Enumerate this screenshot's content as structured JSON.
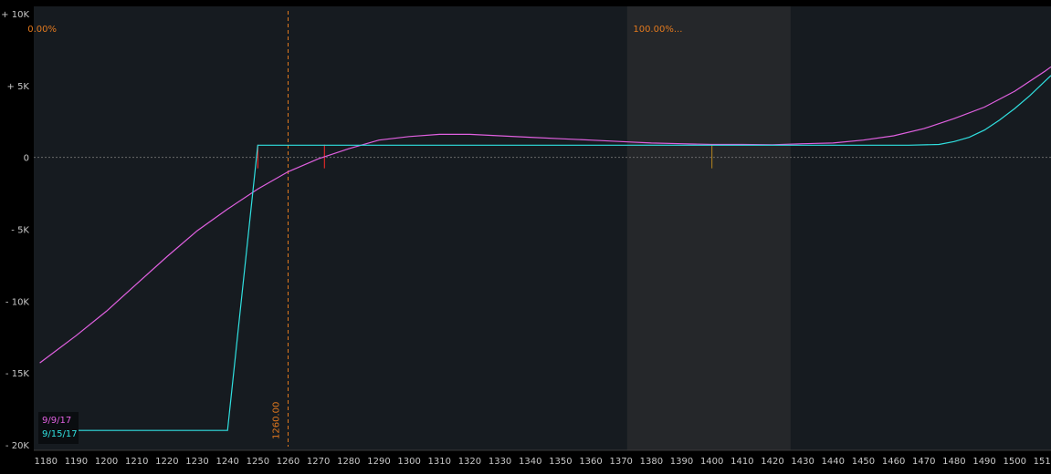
{
  "chart_data": {
    "type": "line",
    "xlim": [
      1176,
      1512
    ],
    "ylim": [
      -20000,
      10000
    ],
    "x_ticks": [
      1180,
      1190,
      1200,
      1210,
      1220,
      1230,
      1240,
      1250,
      1260,
      1270,
      1280,
      1290,
      1300,
      1310,
      1320,
      1330,
      1340,
      1350,
      1360,
      1370,
      1380,
      1390,
      1400,
      1410,
      1420,
      1430,
      1440,
      1450,
      1460,
      1470,
      1480,
      1490,
      1500,
      1510
    ],
    "y_ticks": [
      {
        "value": 10000,
        "label": "+ 10K"
      },
      {
        "value": 5000,
        "label": "+ 5K"
      },
      {
        "value": 0,
        "label": "0"
      },
      {
        "value": -5000,
        "label": "- 5K"
      },
      {
        "value": -10000,
        "label": "- 10K"
      },
      {
        "value": -15000,
        "label": "- 15K"
      },
      {
        "value": -20000,
        "label": "- 20K"
      }
    ],
    "shaded_range": [
      1372,
      1426
    ],
    "price_marker": {
      "x": 1260,
      "label": "1260.00"
    },
    "probability_labels": [
      {
        "x": 1180,
        "text": "0.00%"
      },
      {
        "x": 1380,
        "text": "100.00%..."
      }
    ],
    "zero_line": true,
    "markers": [
      {
        "x": 1250,
        "color": "#ff2a2a"
      },
      {
        "x": 1272,
        "color": "#ff2a2a"
      },
      {
        "x": 1400,
        "color": "#b8861e"
      }
    ],
    "series": [
      {
        "name": "9/9/17",
        "color": "#e060e0",
        "x": [
          1178,
          1190,
          1200,
          1210,
          1220,
          1230,
          1240,
          1250,
          1260,
          1270,
          1280,
          1290,
          1300,
          1310,
          1320,
          1330,
          1340,
          1350,
          1360,
          1370,
          1380,
          1390,
          1400,
          1410,
          1420,
          1430,
          1440,
          1450,
          1460,
          1470,
          1480,
          1490,
          1500,
          1510,
          1512
        ],
        "y": [
          -14300,
          -12400,
          -10700,
          -8800,
          -6900,
          -5100,
          -3600,
          -2200,
          -1000,
          -100,
          600,
          1200,
          1450,
          1600,
          1600,
          1500,
          1400,
          1300,
          1200,
          1100,
          1000,
          950,
          900,
          900,
          870,
          950,
          1000,
          1200,
          1500,
          2000,
          2700,
          3500,
          4600,
          6000,
          6300
        ]
      },
      {
        "name": "9/15/17",
        "color": "#30e0e0",
        "x": [
          1178,
          1240,
          1250,
          1300,
          1350,
          1400,
          1450,
          1465,
          1475,
          1480,
          1485,
          1490,
          1495,
          1500,
          1505,
          1510,
          1512
        ],
        "y": [
          -19000,
          -19000,
          850,
          850,
          850,
          850,
          850,
          850,
          900,
          1100,
          1400,
          1900,
          2600,
          3400,
          4300,
          5300,
          5700
        ]
      }
    ]
  }
}
